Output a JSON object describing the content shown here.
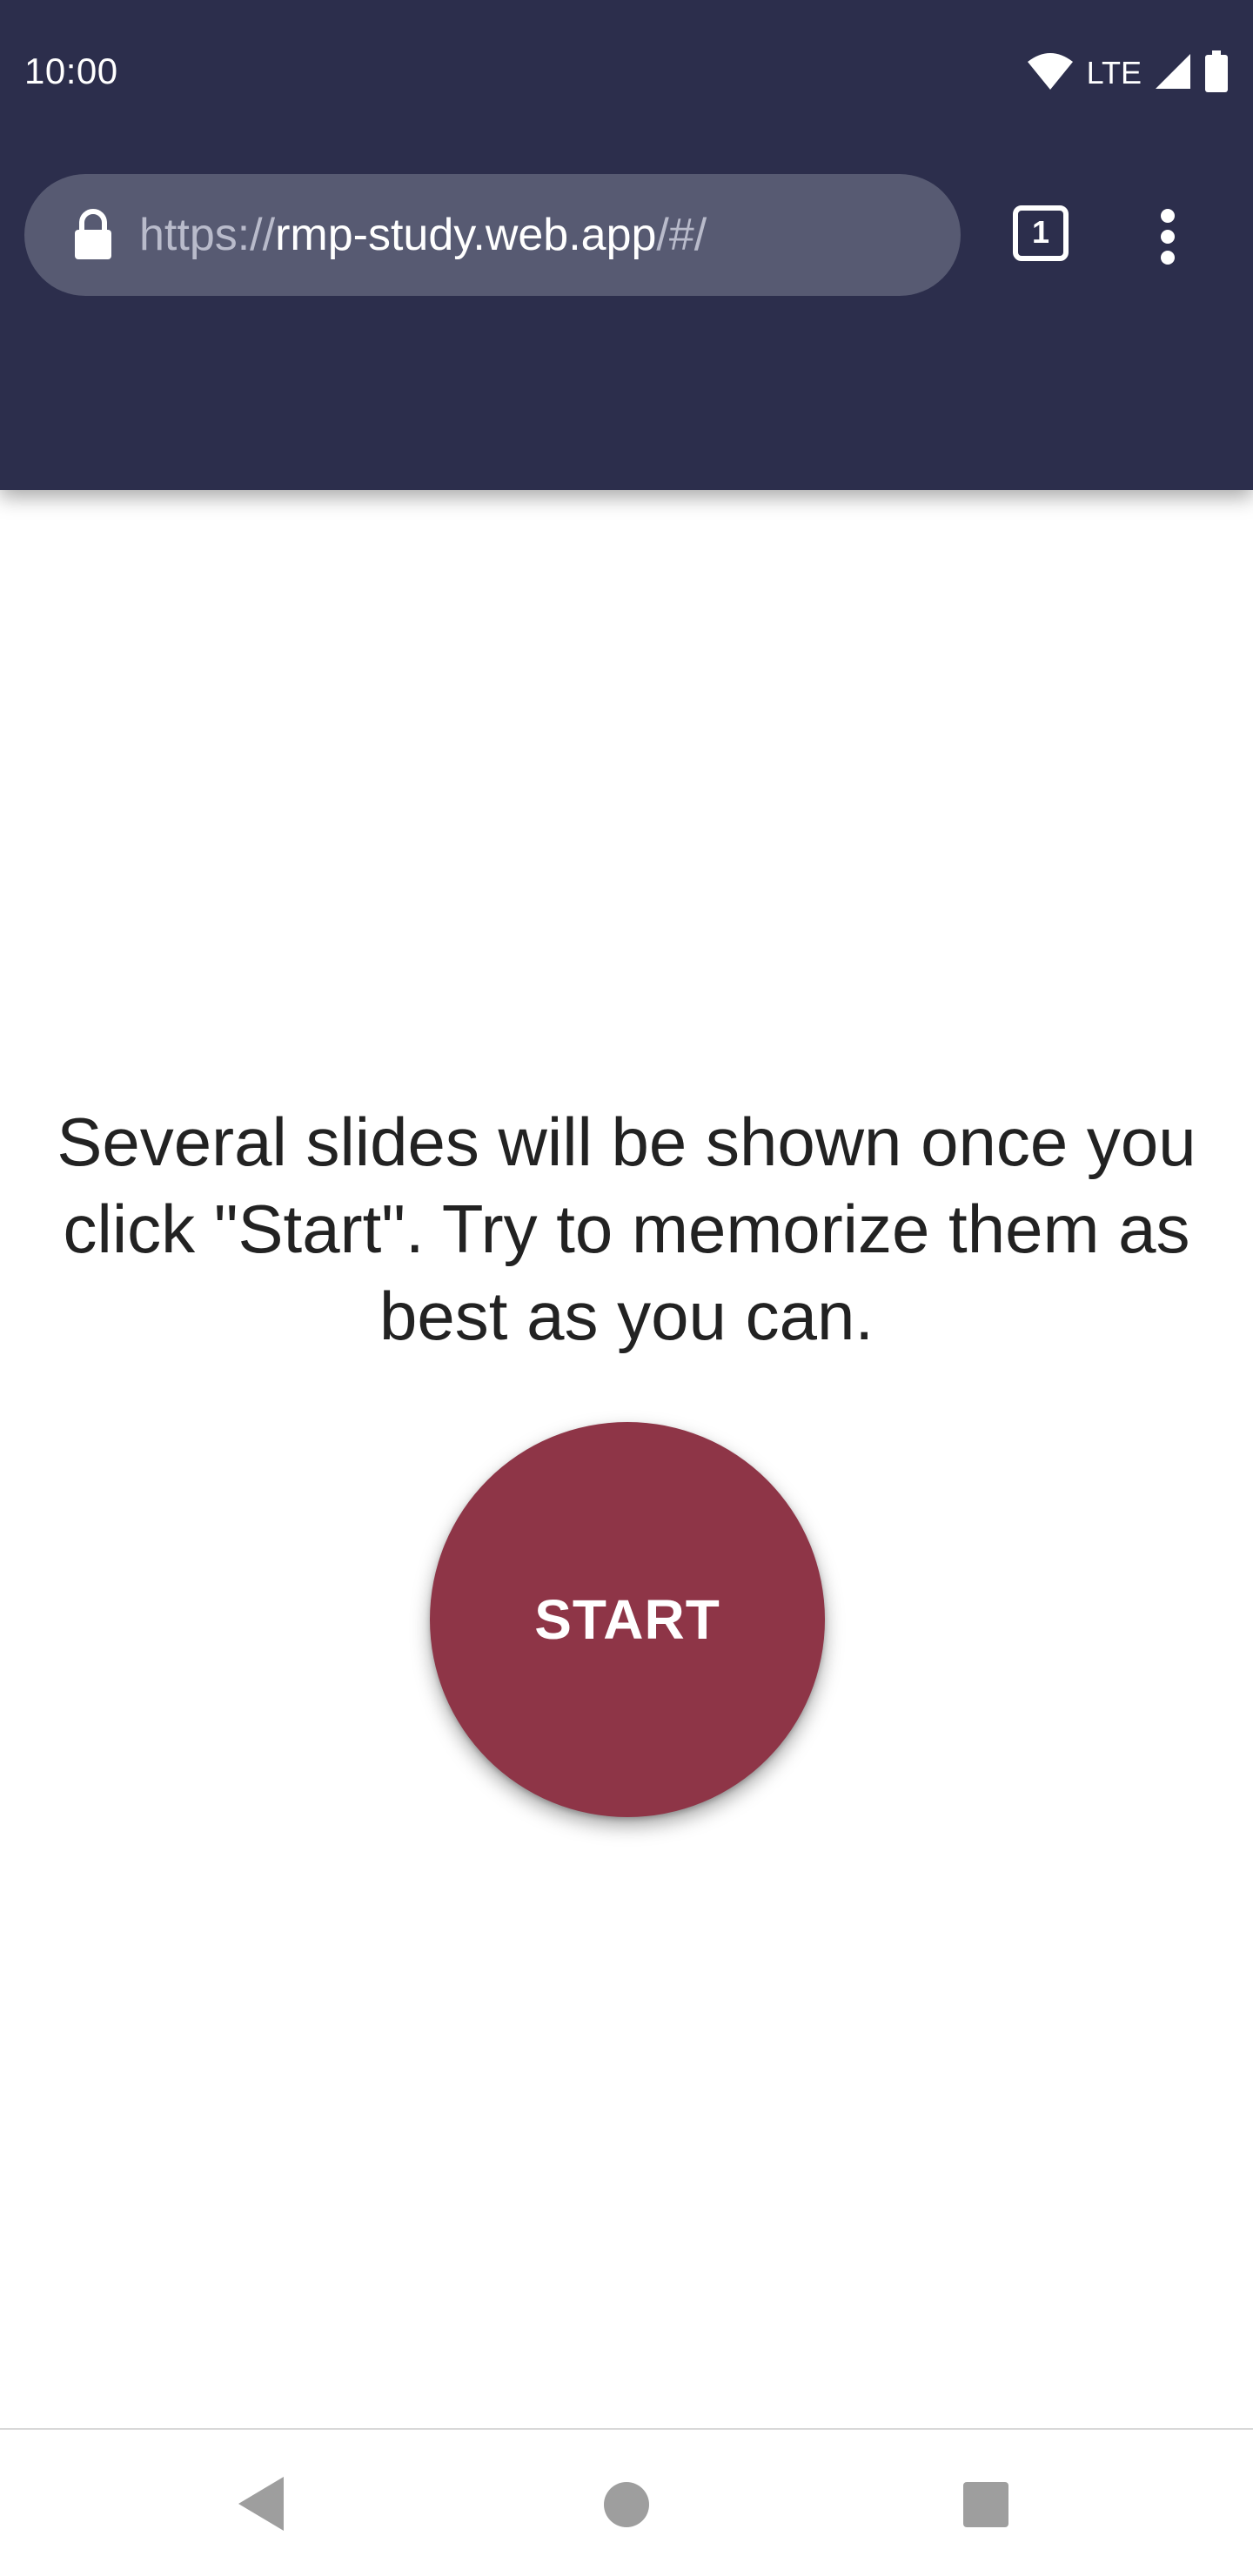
{
  "status_bar": {
    "time": "10:00",
    "network_label": "LTE",
    "icons": [
      "wifi-icon",
      "cell-signal-icon",
      "battery-icon"
    ]
  },
  "browser": {
    "url_scheme": "https://",
    "url_host": "rmp-study.web.app",
    "url_path": "/#/",
    "tab_count": "1",
    "icons": [
      "lock-icon",
      "tabs-icon",
      "overflow-menu-icon"
    ]
  },
  "main": {
    "instructions": "Several slides will be shown once you click \"Start\". Try to memorize them as best as you can.",
    "start_label": "START"
  },
  "nav_bar": {
    "icons": [
      "back-icon",
      "home-icon",
      "recents-icon"
    ]
  },
  "colors": {
    "chrome_background": "#2c2e4c",
    "url_bar_background": "#575a72",
    "start_button": "#8e3547",
    "page_background": "#ffffff"
  }
}
